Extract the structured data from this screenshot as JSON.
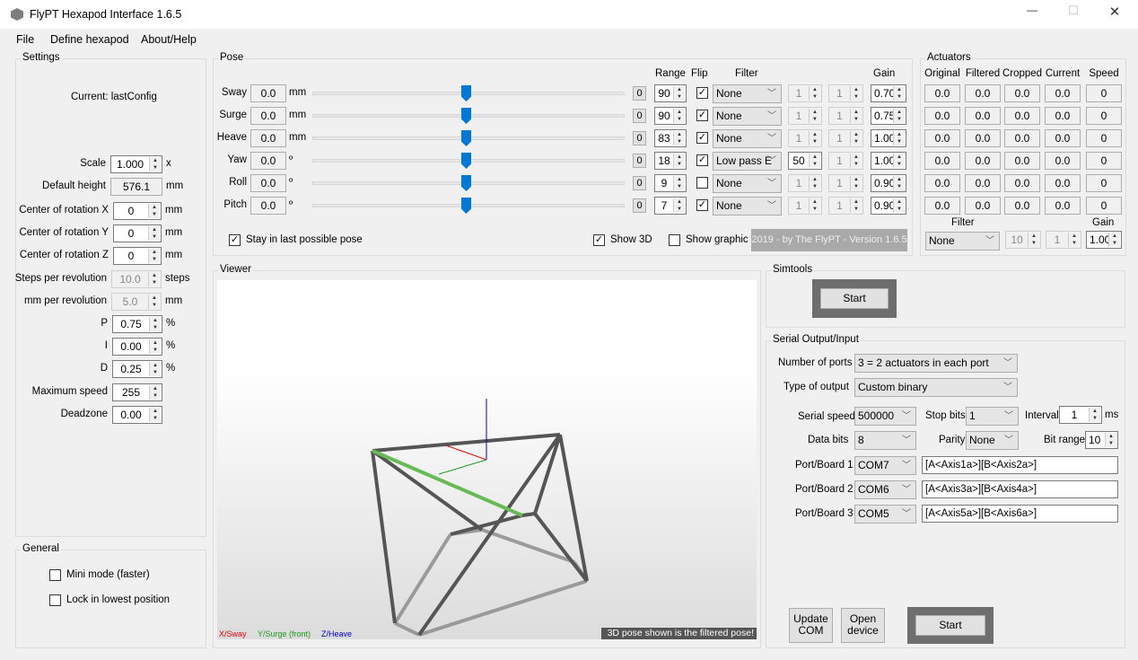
{
  "window": {
    "title": "FlyPT Hexapod Interface 1.6.5",
    "controls": [
      "—",
      "☐",
      "✕"
    ]
  },
  "menu": [
    "File",
    "Define hexapod",
    "About/Help"
  ],
  "settings": {
    "title": "Settings",
    "current": "Current: lastConfig",
    "fields": [
      {
        "label": "Scale",
        "value": "1.000",
        "unit": "x",
        "kind": "spin"
      },
      {
        "label": "Default height",
        "value": "576.1",
        "unit": "mm",
        "kind": "ro"
      },
      {
        "label": "Center of rotation X",
        "value": "0",
        "unit": "mm",
        "kind": "spin"
      },
      {
        "label": "Center of rotation Y",
        "value": "0",
        "unit": "mm",
        "kind": "spin"
      },
      {
        "label": "Center of rotation Z",
        "value": "0",
        "unit": "mm",
        "kind": "spin"
      },
      {
        "label": "Steps per revolution",
        "value": "10.0",
        "unit": "steps",
        "kind": "dis"
      },
      {
        "label": "mm per revolution",
        "value": "5.0",
        "unit": "mm",
        "kind": "dis"
      },
      {
        "label": "P",
        "value": "0.75",
        "unit": "%",
        "kind": "spin"
      },
      {
        "label": "I",
        "value": "0.00",
        "unit": "%",
        "kind": "spin"
      },
      {
        "label": "D",
        "value": "0.25",
        "unit": "%",
        "kind": "spin"
      },
      {
        "label": "Maximum speed",
        "value": "255",
        "unit": "",
        "kind": "spin"
      },
      {
        "label": "Deadzone",
        "value": "0.00",
        "unit": "",
        "kind": "spin"
      }
    ]
  },
  "general": {
    "title": "General",
    "options": [
      {
        "label": "Mini mode (faster)",
        "checked": false
      },
      {
        "label": "Lock in lowest position",
        "checked": false
      }
    ]
  },
  "pose": {
    "title": "Pose",
    "headers": {
      "range": "Range",
      "flip": "Flip",
      "filter": "Filter",
      "gain": "Gain"
    },
    "rows": [
      {
        "label": "Sway",
        "value": "0.0",
        "unit": "mm",
        "offset": "0",
        "range": "90",
        "flip": true,
        "filter": "None",
        "f1": "1",
        "f2": "1",
        "f1_enabled": false,
        "gain": "0.70",
        "slider": 0.5
      },
      {
        "label": "Surge",
        "value": "0.0",
        "unit": "mm",
        "offset": "0",
        "range": "90",
        "flip": true,
        "filter": "None",
        "f1": "1",
        "f2": "1",
        "f1_enabled": false,
        "gain": "0.75",
        "slider": 0.5
      },
      {
        "label": "Heave",
        "value": "0.0",
        "unit": "mm",
        "offset": "0",
        "range": "83",
        "flip": true,
        "filter": "None",
        "f1": "1",
        "f2": "1",
        "f1_enabled": false,
        "gain": "1.00",
        "slider": 0.5
      },
      {
        "label": "Yaw",
        "value": "0.0",
        "unit": "º",
        "offset": "0",
        "range": "18",
        "flip": true,
        "filter": "Low pass E",
        "f1": "50",
        "f2": "1",
        "f1_enabled": true,
        "gain": "1.00",
        "slider": 0.5
      },
      {
        "label": "Roll",
        "value": "0.0",
        "unit": "º",
        "offset": "0",
        "range": "9",
        "flip": false,
        "filter": "None",
        "f1": "1",
        "f2": "1",
        "f1_enabled": false,
        "gain": "0.90",
        "slider": 0.5
      },
      {
        "label": "Pitch",
        "value": "0.0",
        "unit": "º",
        "offset": "0",
        "range": "7",
        "flip": true,
        "filter": "None",
        "f1": "1",
        "f2": "1",
        "f1_enabled": false,
        "gain": "0.90",
        "slider": 0.5
      }
    ],
    "stay_last": {
      "label": "Stay in last possible pose",
      "checked": true
    },
    "show3d": {
      "label": "Show 3D",
      "checked": true
    },
    "show_graphic": {
      "label": "Show graphic",
      "checked": false
    },
    "version": "2019 - by The FlyPT - Version 1.6.5"
  },
  "actuators": {
    "title": "Actuators",
    "headers": [
      "Original",
      "Filtered",
      "Cropped",
      "Current",
      "Speed"
    ],
    "rows": [
      [
        "0.0",
        "0.0",
        "0.0",
        "0.0",
        "0"
      ],
      [
        "0.0",
        "0.0",
        "0.0",
        "0.0",
        "0"
      ],
      [
        "0.0",
        "0.0",
        "0.0",
        "0.0",
        "0"
      ],
      [
        "0.0",
        "0.0",
        "0.0",
        "0.0",
        "0"
      ],
      [
        "0.0",
        "0.0",
        "0.0",
        "0.0",
        "0"
      ],
      [
        "0.0",
        "0.0",
        "0.0",
        "0.0",
        "0"
      ]
    ],
    "filter_label": "Filter",
    "filter": "None",
    "f1": "10",
    "f2": "1",
    "gain_label": "Gain",
    "gain": "1.00"
  },
  "viewer": {
    "title": "Viewer",
    "axis_x": "X/Sway",
    "axis_y": "Y/Surge (front)",
    "axis_z": "Z/Heave",
    "note": "3D pose shown is the filtered pose!",
    "colors": {
      "x": "#e00000",
      "y": "#1a9a1a",
      "z": "#0000cc"
    }
  },
  "simtools": {
    "title": "Simtools",
    "start": "Start"
  },
  "serial": {
    "title": "Serial Output/Input",
    "ports_label": "Number of ports",
    "ports": "3 = 2 actuators in each port",
    "type_label": "Type of output",
    "type": "Custom binary",
    "speed_label": "Serial speed",
    "speed": "500000",
    "stop_label": "Stop bits",
    "stop": "1",
    "interval_label": "Interval",
    "interval": "1",
    "interval_unit": "ms",
    "data_label": "Data bits",
    "data": "8",
    "parity_label": "Parity",
    "parity": "None",
    "bitrange_label": "Bit range",
    "bitrange": "10",
    "boards": [
      {
        "label": "Port/Board 1",
        "port": "COM7",
        "format": "[A<Axis1a>][B<Axis2a>]"
      },
      {
        "label": "Port/Board 2",
        "port": "COM6",
        "format": "[A<Axis3a>][B<Axis4a>]"
      },
      {
        "label": "Port/Board 3",
        "port": "COM5",
        "format": "[A<Axis5a>][B<Axis6a>]"
      }
    ],
    "update_com": "Update COM",
    "open_device": "Open device",
    "start": "Start"
  }
}
